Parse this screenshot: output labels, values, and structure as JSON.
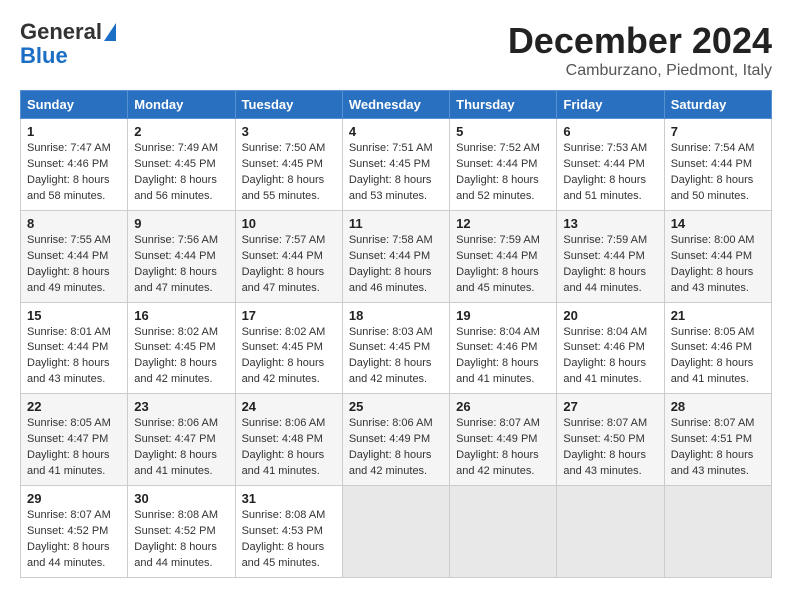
{
  "header": {
    "logo_line1": "General",
    "logo_line2": "Blue",
    "title": "December 2024",
    "subtitle": "Camburzano, Piedmont, Italy"
  },
  "weekdays": [
    "Sunday",
    "Monday",
    "Tuesday",
    "Wednesday",
    "Thursday",
    "Friday",
    "Saturday"
  ],
  "weeks": [
    [
      {
        "day": "1",
        "sunrise": "7:47 AM",
        "sunset": "4:46 PM",
        "daylight": "8 hours and 58 minutes."
      },
      {
        "day": "2",
        "sunrise": "7:49 AM",
        "sunset": "4:45 PM",
        "daylight": "8 hours and 56 minutes."
      },
      {
        "day": "3",
        "sunrise": "7:50 AM",
        "sunset": "4:45 PM",
        "daylight": "8 hours and 55 minutes."
      },
      {
        "day": "4",
        "sunrise": "7:51 AM",
        "sunset": "4:45 PM",
        "daylight": "8 hours and 53 minutes."
      },
      {
        "day": "5",
        "sunrise": "7:52 AM",
        "sunset": "4:44 PM",
        "daylight": "8 hours and 52 minutes."
      },
      {
        "day": "6",
        "sunrise": "7:53 AM",
        "sunset": "4:44 PM",
        "daylight": "8 hours and 51 minutes."
      },
      {
        "day": "7",
        "sunrise": "7:54 AM",
        "sunset": "4:44 PM",
        "daylight": "8 hours and 50 minutes."
      }
    ],
    [
      {
        "day": "8",
        "sunrise": "7:55 AM",
        "sunset": "4:44 PM",
        "daylight": "8 hours and 49 minutes."
      },
      {
        "day": "9",
        "sunrise": "7:56 AM",
        "sunset": "4:44 PM",
        "daylight": "8 hours and 47 minutes."
      },
      {
        "day": "10",
        "sunrise": "7:57 AM",
        "sunset": "4:44 PM",
        "daylight": "8 hours and 47 minutes."
      },
      {
        "day": "11",
        "sunrise": "7:58 AM",
        "sunset": "4:44 PM",
        "daylight": "8 hours and 46 minutes."
      },
      {
        "day": "12",
        "sunrise": "7:59 AM",
        "sunset": "4:44 PM",
        "daylight": "8 hours and 45 minutes."
      },
      {
        "day": "13",
        "sunrise": "7:59 AM",
        "sunset": "4:44 PM",
        "daylight": "8 hours and 44 minutes."
      },
      {
        "day": "14",
        "sunrise": "8:00 AM",
        "sunset": "4:44 PM",
        "daylight": "8 hours and 43 minutes."
      }
    ],
    [
      {
        "day": "15",
        "sunrise": "8:01 AM",
        "sunset": "4:44 PM",
        "daylight": "8 hours and 43 minutes."
      },
      {
        "day": "16",
        "sunrise": "8:02 AM",
        "sunset": "4:45 PM",
        "daylight": "8 hours and 42 minutes."
      },
      {
        "day": "17",
        "sunrise": "8:02 AM",
        "sunset": "4:45 PM",
        "daylight": "8 hours and 42 minutes."
      },
      {
        "day": "18",
        "sunrise": "8:03 AM",
        "sunset": "4:45 PM",
        "daylight": "8 hours and 42 minutes."
      },
      {
        "day": "19",
        "sunrise": "8:04 AM",
        "sunset": "4:46 PM",
        "daylight": "8 hours and 41 minutes."
      },
      {
        "day": "20",
        "sunrise": "8:04 AM",
        "sunset": "4:46 PM",
        "daylight": "8 hours and 41 minutes."
      },
      {
        "day": "21",
        "sunrise": "8:05 AM",
        "sunset": "4:46 PM",
        "daylight": "8 hours and 41 minutes."
      }
    ],
    [
      {
        "day": "22",
        "sunrise": "8:05 AM",
        "sunset": "4:47 PM",
        "daylight": "8 hours and 41 minutes."
      },
      {
        "day": "23",
        "sunrise": "8:06 AM",
        "sunset": "4:47 PM",
        "daylight": "8 hours and 41 minutes."
      },
      {
        "day": "24",
        "sunrise": "8:06 AM",
        "sunset": "4:48 PM",
        "daylight": "8 hours and 41 minutes."
      },
      {
        "day": "25",
        "sunrise": "8:06 AM",
        "sunset": "4:49 PM",
        "daylight": "8 hours and 42 minutes."
      },
      {
        "day": "26",
        "sunrise": "8:07 AM",
        "sunset": "4:49 PM",
        "daylight": "8 hours and 42 minutes."
      },
      {
        "day": "27",
        "sunrise": "8:07 AM",
        "sunset": "4:50 PM",
        "daylight": "8 hours and 43 minutes."
      },
      {
        "day": "28",
        "sunrise": "8:07 AM",
        "sunset": "4:51 PM",
        "daylight": "8 hours and 43 minutes."
      }
    ],
    [
      {
        "day": "29",
        "sunrise": "8:07 AM",
        "sunset": "4:52 PM",
        "daylight": "8 hours and 44 minutes."
      },
      {
        "day": "30",
        "sunrise": "8:08 AM",
        "sunset": "4:52 PM",
        "daylight": "8 hours and 44 minutes."
      },
      {
        "day": "31",
        "sunrise": "8:08 AM",
        "sunset": "4:53 PM",
        "daylight": "8 hours and 45 minutes."
      },
      null,
      null,
      null,
      null
    ]
  ],
  "labels": {
    "sunrise": "Sunrise:",
    "sunset": "Sunset:",
    "daylight": "Daylight:"
  }
}
